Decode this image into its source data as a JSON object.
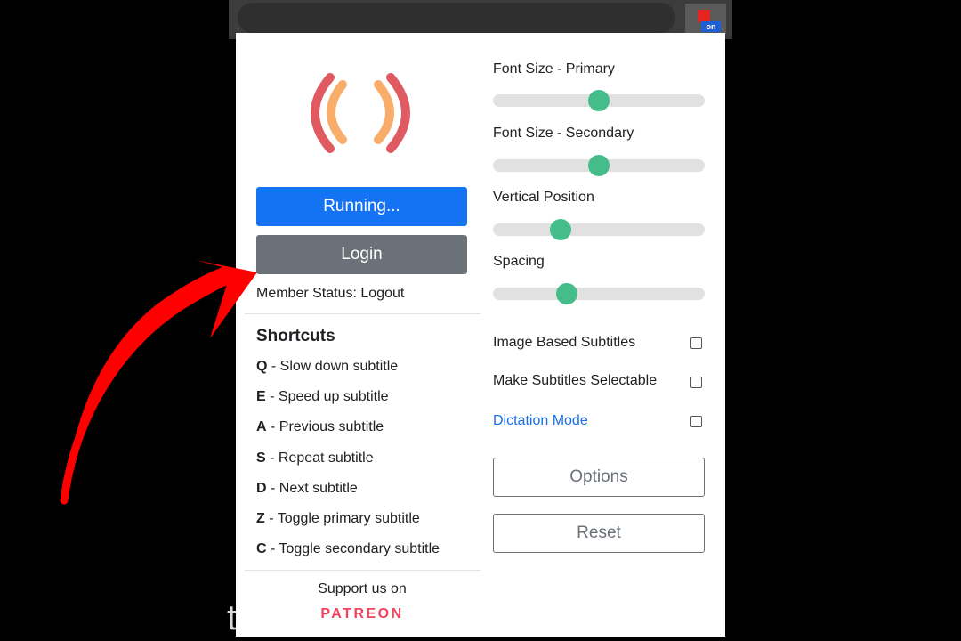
{
  "browser": {
    "extension_badge": "on",
    "background_text": "t"
  },
  "popup": {
    "logo_icon": "parentheses-logo-icon",
    "buttons": {
      "running": "Running...",
      "login": "Login",
      "options": "Options",
      "reset": "Reset"
    },
    "member_status": "Member Status: Logout",
    "shortcuts": {
      "title": "Shortcuts",
      "items": [
        {
          "key": "Q",
          "label": " - Slow down subtitle"
        },
        {
          "key": "E",
          "label": " - Speed up subtitle"
        },
        {
          "key": "A",
          "label": " - Previous subtitle"
        },
        {
          "key": "S",
          "label": " - Repeat subtitle"
        },
        {
          "key": "D",
          "label": " - Next subtitle"
        },
        {
          "key": "Z",
          "label": " - Toggle primary subtitle"
        },
        {
          "key": "C",
          "label": " - Toggle secondary subtitle"
        }
      ]
    },
    "support": {
      "text": "Support us on",
      "brand": "PATREON"
    },
    "sliders": [
      {
        "label": "Font Size - Primary",
        "value": 0.5
      },
      {
        "label": "Font Size - Secondary",
        "value": 0.5
      },
      {
        "label": "Vertical Position",
        "value": 0.32
      },
      {
        "label": "Spacing",
        "value": 0.35
      }
    ],
    "checkboxes": [
      {
        "label": "Image Based Subtitles",
        "checked": false
      },
      {
        "label": "Make Subtitles Selectable",
        "checked": false
      },
      {
        "label": "Dictation Mode",
        "checked": false
      }
    ]
  },
  "colors": {
    "primary_button": "#1473f2",
    "secondary_button": "#6b7178",
    "slider_thumb": "#45bd8a",
    "link": "#1a6ee6",
    "patreon": "#f0435f",
    "annotation_arrow": "#ff0000",
    "logo_outer": "#e05a62",
    "logo_inner": "#f8ad6a"
  }
}
